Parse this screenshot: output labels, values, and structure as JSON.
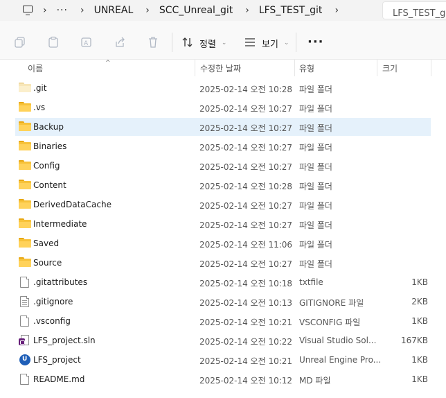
{
  "breadcrumb": {
    "more": "···",
    "items": [
      "UNREAL",
      "SCC_Unreal_git",
      "LFS_TEST_git"
    ]
  },
  "search": {
    "placeholder": "LFS_TEST_git 검색"
  },
  "toolbar": {
    "sort_label": "정렬",
    "view_label": "보기",
    "more_label": "···"
  },
  "columns": {
    "name": "이름",
    "date": "수정한 날짜",
    "type": "유형",
    "size": "크기"
  },
  "files": [
    {
      "name": ".git",
      "date": "2025-02-14 오전 10:28",
      "type": "파일 폴더",
      "size": "",
      "icon": "folder-light-icon"
    },
    {
      "name": ".vs",
      "date": "2025-02-14 오전 10:27",
      "type": "파일 폴더",
      "size": "",
      "icon": "folder-icon"
    },
    {
      "name": "Backup",
      "date": "2025-02-14 오전 10:27",
      "type": "파일 폴더",
      "size": "",
      "icon": "folder-icon",
      "selected": true
    },
    {
      "name": "Binaries",
      "date": "2025-02-14 오전 10:27",
      "type": "파일 폴더",
      "size": "",
      "icon": "folder-icon"
    },
    {
      "name": "Config",
      "date": "2025-02-14 오전 10:27",
      "type": "파일 폴더",
      "size": "",
      "icon": "folder-icon"
    },
    {
      "name": "Content",
      "date": "2025-02-14 오전 10:28",
      "type": "파일 폴더",
      "size": "",
      "icon": "folder-icon"
    },
    {
      "name": "DerivedDataCache",
      "date": "2025-02-14 오전 10:27",
      "type": "파일 폴더",
      "size": "",
      "icon": "folder-icon"
    },
    {
      "name": "Intermediate",
      "date": "2025-02-14 오전 10:27",
      "type": "파일 폴더",
      "size": "",
      "icon": "folder-icon"
    },
    {
      "name": "Saved",
      "date": "2025-02-14 오전 11:06",
      "type": "파일 폴더",
      "size": "",
      "icon": "folder-icon"
    },
    {
      "name": "Source",
      "date": "2025-02-14 오전 10:27",
      "type": "파일 폴더",
      "size": "",
      "icon": "folder-icon"
    },
    {
      "name": ".gitattributes",
      "date": "2025-02-14 오전 10:18",
      "type": "txtfile",
      "size": "1KB",
      "icon": "document-icon"
    },
    {
      "name": ".gitignore",
      "date": "2025-02-14 오전 10:13",
      "type": "GITIGNORE 파일",
      "size": "2KB",
      "icon": "text-document-icon"
    },
    {
      "name": ".vsconfig",
      "date": "2025-02-14 오전 10:21",
      "type": "VSCONFIG 파일",
      "size": "1KB",
      "icon": "document-icon"
    },
    {
      "name": "LFS_project.sln",
      "date": "2025-02-14 오전 10:22",
      "type": "Visual Studio Sol...",
      "size": "167KB",
      "icon": "visual-studio-solution-icon"
    },
    {
      "name": "LFS_project",
      "date": "2025-02-14 오전 10:21",
      "type": "Unreal Engine Pro...",
      "size": "1KB",
      "icon": "unreal-engine-icon"
    },
    {
      "name": "README.md",
      "date": "2025-02-14 오전 10:12",
      "type": "MD 파일",
      "size": "1KB",
      "icon": "document-icon"
    }
  ],
  "colors": {
    "folder": "#f7c23a",
    "selection": "#e5f1fb",
    "vs_purple": "#68217a",
    "unreal_blue": "#1f5fb8"
  }
}
